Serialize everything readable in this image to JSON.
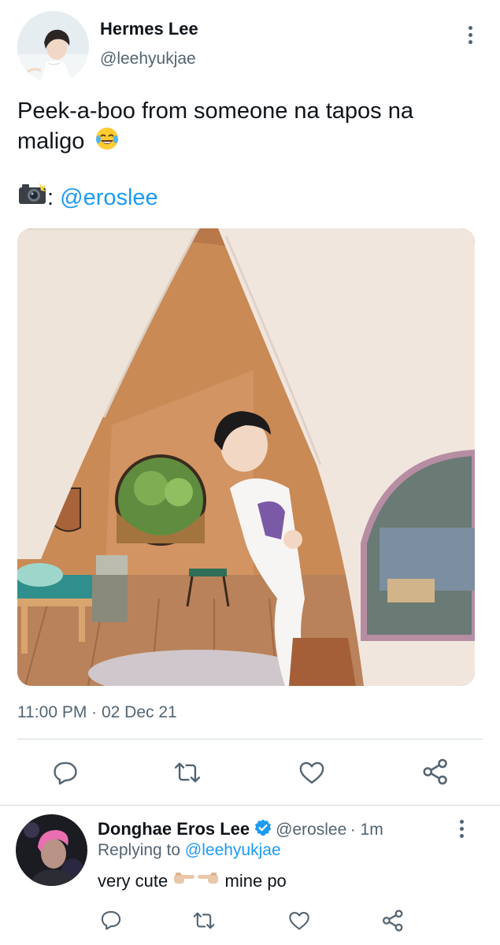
{
  "tweet": {
    "author_name": "Hermes Lee",
    "author_handle": "@leehyukjae",
    "text_line1": "Peek-a-boo from someone na tapos na",
    "text_line2": "maligo",
    "text_line2_emoji": "face-with-tears-of-joy-icon",
    "credit_suffix": ":",
    "credit_emoji": "camera-with-flash-icon",
    "credit_mention": "@eroslee",
    "timestamp": "11:00 PM · 02 Dec 21",
    "image_alt": "person peeking out from between tent flaps"
  },
  "actions": {
    "icons": [
      "reply-icon",
      "retweet-icon",
      "like-icon",
      "share-icon"
    ]
  },
  "reply": {
    "author_name": "Donghae Eros Lee",
    "verified_icon": "verified-badge-icon",
    "author_handle": "@eroslee",
    "time": "· 1m",
    "replying_prefix": "Replying to",
    "replying_mention": "@leehyukjae",
    "text_part1": "very cute",
    "text_emojis": [
      "pointing-right-hand-icon",
      "pointing-left-hand-icon"
    ],
    "text_part2": "mine po"
  },
  "colors": {
    "accent": "#1d9bf0",
    "secondary_text": "#536471",
    "divider": "#cfd9de"
  }
}
